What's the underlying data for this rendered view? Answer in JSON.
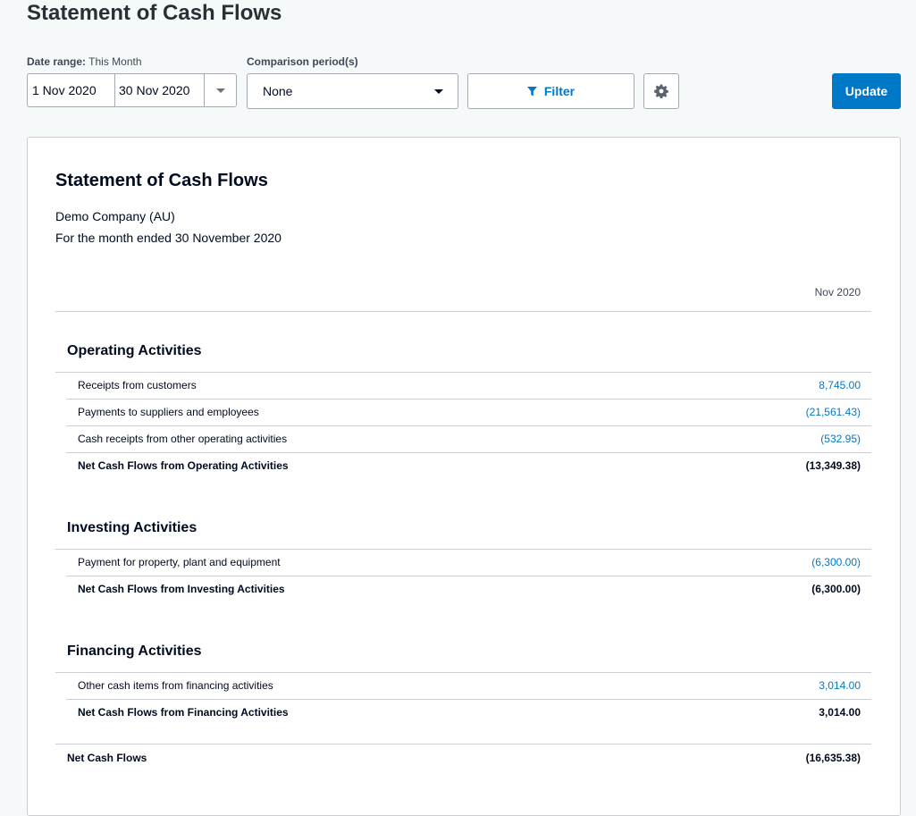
{
  "page": {
    "title": "Statement of Cash Flows"
  },
  "controls": {
    "date_range_label": "Date range:",
    "date_range_value": "This Month",
    "start_date": "1 Nov 2020",
    "end_date": "30 Nov 2020",
    "comparison_label": "Comparison period(s)",
    "comparison_value": "None",
    "filter_label": "Filter",
    "update_label": "Update"
  },
  "colors": {
    "accent": "#0078c8",
    "text": "#000a1e",
    "border": "#ccced2"
  },
  "report": {
    "title": "Statement of Cash Flows",
    "company": "Demo Company (AU)",
    "period": "For the month ended 30 November 2020",
    "column_header": "Nov 2020",
    "sections": [
      {
        "title": "Operating Activities",
        "rows": [
          {
            "label": "Receipts from customers",
            "value": "8,745.00"
          },
          {
            "label": "Payments to suppliers and employees",
            "value": "(21,561.43)"
          },
          {
            "label": "Cash receipts from other operating activities",
            "value": "(532.95)"
          }
        ],
        "total": {
          "label": "Net Cash Flows from Operating Activities",
          "value": "(13,349.38)"
        }
      },
      {
        "title": "Investing Activities",
        "rows": [
          {
            "label": "Payment for property, plant and equipment",
            "value": "(6,300.00)"
          }
        ],
        "total": {
          "label": "Net Cash Flows from Investing Activities",
          "value": "(6,300.00)"
        }
      },
      {
        "title": "Financing Activities",
        "rows": [
          {
            "label": "Other cash items from financing activities",
            "value": "3,014.00"
          }
        ],
        "total": {
          "label": "Net Cash Flows from Financing Activities",
          "value": "3,014.00"
        }
      }
    ],
    "grand_total": {
      "label": "Net Cash Flows",
      "value": "(16,635.38)"
    }
  }
}
